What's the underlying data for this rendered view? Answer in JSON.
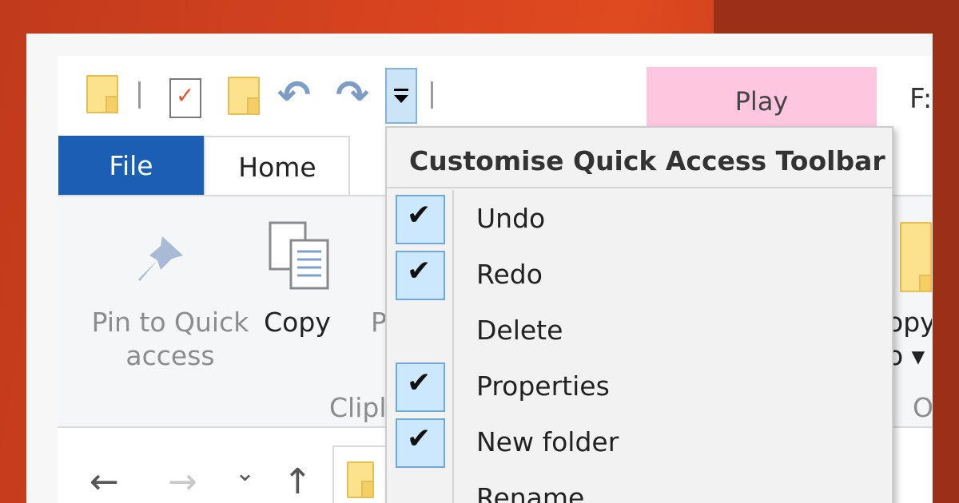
{
  "window": {
    "title_fragment": "F:"
  },
  "qat": {
    "icons": [
      "folder-icon",
      "properties-icon",
      "new-folder-icon",
      "undo-icon",
      "redo-icon",
      "chevron-down-icon"
    ]
  },
  "tabs": {
    "file": "File",
    "home": "Home",
    "play": "Play"
  },
  "ribbon": {
    "pin_label_line1": "Pin to Quick",
    "pin_label_line2": "access",
    "copy_label": "Copy",
    "partial_paste": "P",
    "group_clipboard_partial": "Clipl",
    "right_label_line1": "opy",
    "right_label_line2": "o ▾",
    "right_group_partial": "O"
  },
  "menu": {
    "title": "Customise Quick Access Toolbar",
    "items": [
      {
        "label": "Undo",
        "checked": true
      },
      {
        "label": "Redo",
        "checked": true
      },
      {
        "label": "Delete",
        "checked": false
      },
      {
        "label": "Properties",
        "checked": true
      },
      {
        "label": "New folder",
        "checked": true
      },
      {
        "label": "Rename",
        "checked": false
      }
    ]
  },
  "nav": {
    "back": "←",
    "forward": "→",
    "recent": "⌄",
    "up": "↑"
  },
  "colors": {
    "file_tab": "#1a5fb4",
    "play_tab": "#ffc6e0",
    "checkbox_fill": "#cce8ff",
    "folder": "#fde28d"
  }
}
